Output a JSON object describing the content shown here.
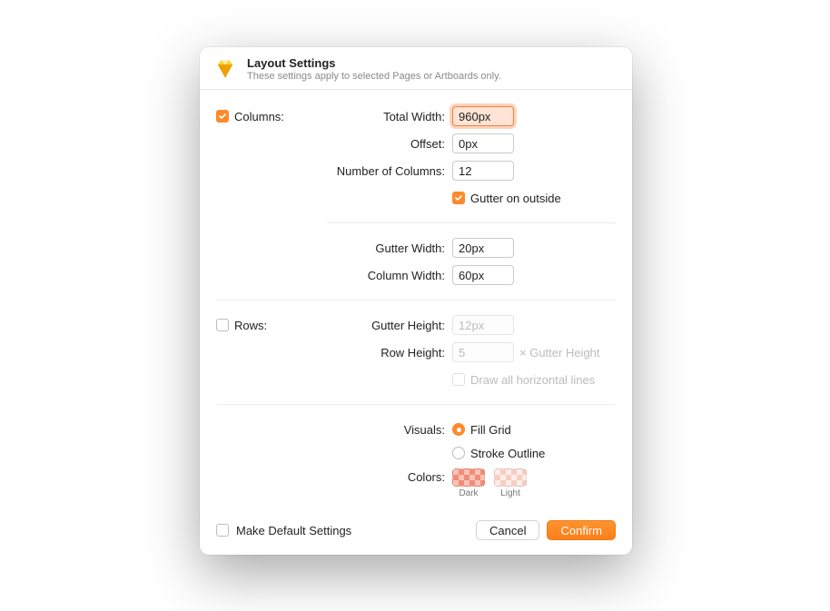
{
  "header": {
    "title": "Layout Settings",
    "subtitle": "These settings apply to selected Pages or Artboards only."
  },
  "columns": {
    "section_label": "Columns:",
    "enabled": true,
    "total_width_label": "Total Width:",
    "total_width_value": "960px",
    "offset_label": "Offset:",
    "offset_value": "0px",
    "num_columns_label": "Number of Columns:",
    "num_columns_value": "12",
    "gutter_outside_label": "Gutter on outside",
    "gutter_outside_checked": true,
    "gutter_width_label": "Gutter Width:",
    "gutter_width_value": "20px",
    "column_width_label": "Column Width:",
    "column_width_value": "60px"
  },
  "rows": {
    "section_label": "Rows:",
    "enabled": false,
    "gutter_height_label": "Gutter Height:",
    "gutter_height_value": "12px",
    "row_height_label": "Row Height:",
    "row_height_value": "5",
    "row_height_suffix": "× Gutter Height",
    "draw_lines_label": "Draw all horizontal lines",
    "draw_lines_checked": false
  },
  "visuals": {
    "label": "Visuals:",
    "fill_grid_label": "Fill Grid",
    "stroke_outline_label": "Stroke Outline",
    "selected": "fill"
  },
  "colors": {
    "label": "Colors:",
    "dark_label": "Dark",
    "light_label": "Light"
  },
  "footer": {
    "make_default_label": "Make Default Settings",
    "make_default_checked": false,
    "cancel_label": "Cancel",
    "confirm_label": "Confirm"
  }
}
